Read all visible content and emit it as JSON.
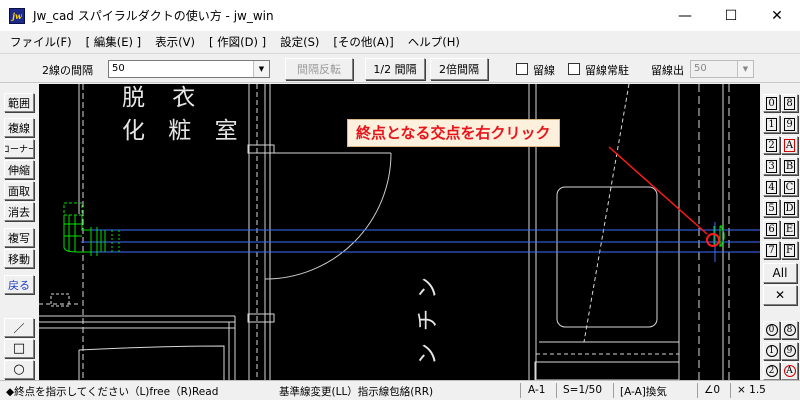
{
  "window": {
    "title": "Jw_cad スパイラルダクトの使い方 - jw_win",
    "icon_text": "jw",
    "minimize": "—",
    "maximize": "☐",
    "close": "✕"
  },
  "menu": [
    "ファイル(F)",
    "[ 編集(E) ]",
    "表示(V)",
    "[ 作図(D) ]",
    "設定(S)",
    "[その他(A)]",
    "ヘルプ(H)"
  ],
  "toolbar": {
    "spacing_label": "2線の間隔",
    "spacing_value": "50",
    "invert_button": "間隔反転",
    "half_button": "1/2 間隔",
    "double_button": "2倍間隔",
    "tome_label": "留線",
    "tome_always_label": "留線常駐",
    "tome_out_label": "留線出",
    "tome_out_value": "50"
  },
  "left_tools": [
    "範囲",
    "複線",
    "コーナー",
    "伸縮",
    "面取",
    "消去",
    "複写",
    "移動",
    "戻る",
    "／",
    "□",
    "○"
  ],
  "right_tools": {
    "col1": [
      "0",
      "1",
      "2",
      "3",
      "4",
      "5",
      "6",
      "7"
    ],
    "col2": [
      "8",
      "9",
      "A",
      "B",
      "C",
      "D",
      "E",
      "F"
    ],
    "all_label": "All",
    "cross_label": "✕",
    "layer_col1": [
      "0",
      "1",
      "2"
    ],
    "layer_col2": [
      "8",
      "9",
      "A"
    ]
  },
  "canvas": {
    "room_label_line1": "脱 衣",
    "room_label_line2": "化 粧 室",
    "vertical_text": [
      "ン",
      "チ",
      "ン"
    ],
    "annotation": "終点となる交点を右クリック",
    "colors": {
      "background": "#000000",
      "duct": "#00e000",
      "centerline": "#3b6cff",
      "wall": "#d8d8d8",
      "annotation_text": "#e8141c",
      "marker": "#ff1a1a"
    }
  },
  "status": {
    "message": "◆終点を指示してください（L)free（R)Read",
    "hint": "基準線変更(LL）指示線包絡(RR)",
    "paper": "A-1",
    "scale": "S=1/50",
    "layer": "[A-A]換気",
    "angle": "∠0",
    "ratio": "× 1.5"
  }
}
